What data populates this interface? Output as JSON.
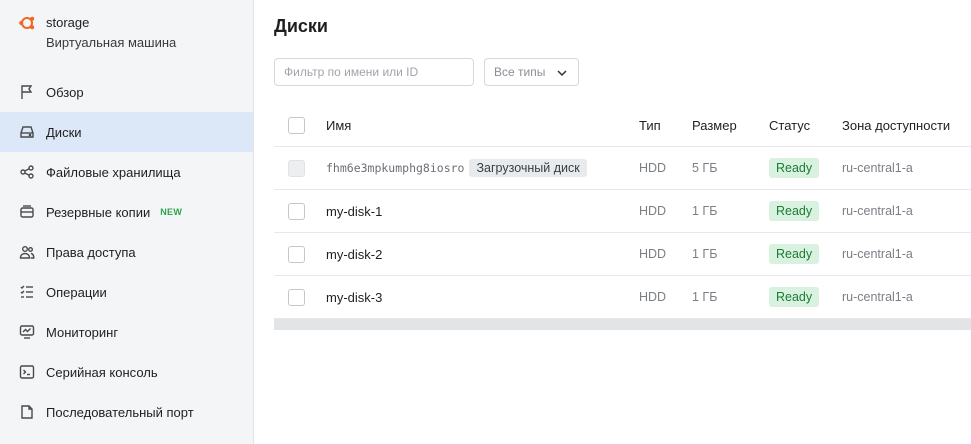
{
  "vm": {
    "name": "storage",
    "type": "Виртуальная машина"
  },
  "nav": [
    {
      "label": "Обзор",
      "icon": "flag-icon"
    },
    {
      "label": "Диски",
      "icon": "disk-icon",
      "active": true
    },
    {
      "label": "Файловые хранилища",
      "icon": "share-icon"
    },
    {
      "label": "Резервные копии",
      "icon": "backup-icon",
      "badge": "NEW"
    },
    {
      "label": "Права доступа",
      "icon": "users-icon"
    },
    {
      "label": "Операции",
      "icon": "checklist-icon"
    },
    {
      "label": "Мониторинг",
      "icon": "monitor-icon"
    },
    {
      "label": "Серийная консоль",
      "icon": "terminal-icon"
    },
    {
      "label": "Последовательный порт",
      "icon": "file-icon"
    }
  ],
  "page": {
    "title": "Диски",
    "filter_placeholder": "Фильтр по имени или ID",
    "type_select": "Все типы"
  },
  "table": {
    "columns": {
      "name": "Имя",
      "type": "Тип",
      "size": "Размер",
      "status": "Статус",
      "zone": "Зона доступности"
    },
    "rows": [
      {
        "name": "fhm6e3mpkumphg8iosro",
        "tag": "Загрузочный диск",
        "type": "HDD",
        "size": "5 ГБ",
        "status": "Ready",
        "zone": "ru-central1-a",
        "boot": true
      },
      {
        "name": "my-disk-1",
        "type": "HDD",
        "size": "1 ГБ",
        "status": "Ready",
        "zone": "ru-central1-a"
      },
      {
        "name": "my-disk-2",
        "type": "HDD",
        "size": "1 ГБ",
        "status": "Ready",
        "zone": "ru-central1-a"
      },
      {
        "name": "my-disk-3",
        "type": "HDD",
        "size": "1 ГБ",
        "status": "Ready",
        "zone": "ru-central1-a"
      }
    ]
  },
  "colors": {
    "accent_active": "#dce7f8",
    "status_bg": "#d9f2df",
    "status_text": "#1d7a36",
    "vm_icon": "#f26522",
    "badge_new": "#2ea44f"
  }
}
